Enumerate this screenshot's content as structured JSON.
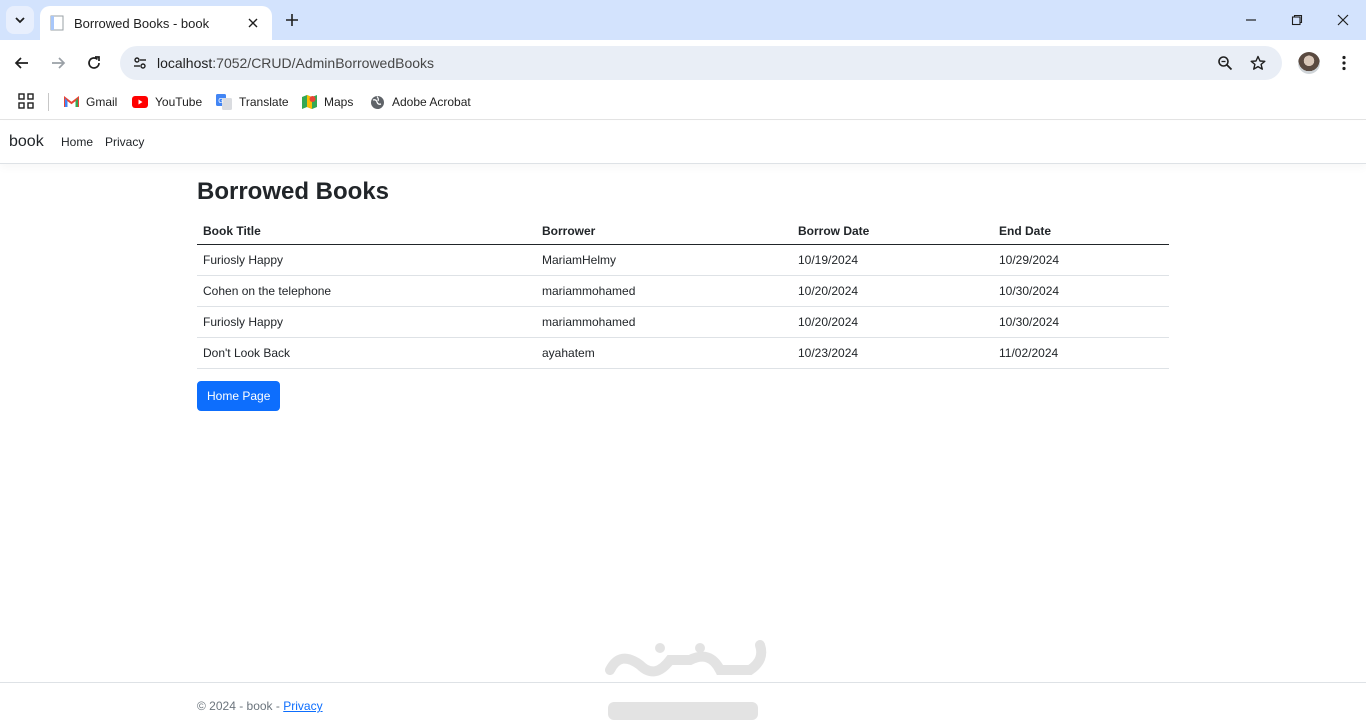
{
  "browser": {
    "tab_title": "Borrowed Books - book",
    "url_host": "localhost",
    "url_path": ":7052/CRUD/AdminBorrowedBooks",
    "bookmarks": [
      {
        "label": "Gmail",
        "icon": "gmail-icon"
      },
      {
        "label": "YouTube",
        "icon": "youtube-icon"
      },
      {
        "label": "Translate",
        "icon": "translate-icon"
      },
      {
        "label": "Maps",
        "icon": "maps-icon"
      },
      {
        "label": "Adobe Acrobat",
        "icon": "globe-icon"
      }
    ]
  },
  "navbar": {
    "brand": "book",
    "links": [
      "Home",
      "Privacy"
    ]
  },
  "main": {
    "title": "Borrowed Books",
    "columns": [
      "Book Title",
      "Borrower",
      "Borrow Date",
      "End Date"
    ],
    "rows": [
      [
        "Furiosly Happy",
        "MariamHelmy",
        "10/19/2024",
        "10/29/2024"
      ],
      [
        "Cohen on the telephone",
        "mariammohamed",
        "10/20/2024",
        "10/30/2024"
      ],
      [
        "Furiosly Happy",
        "mariammohamed",
        "10/20/2024",
        "10/30/2024"
      ],
      [
        "Don't Look Back",
        "ayahatem",
        "10/23/2024",
        "11/02/2024"
      ]
    ],
    "home_button": "Home Page"
  },
  "footer": {
    "text": "© 2024 - book - ",
    "link": "Privacy"
  },
  "colors": {
    "primary": "#0d6efd",
    "tabstrip": "#d3e3fd"
  }
}
